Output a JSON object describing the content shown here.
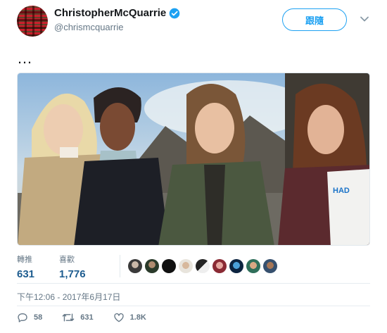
{
  "user": {
    "display_name": "ChristopherMcQuarrie",
    "handle": "@chrismcquarrie",
    "verified": true
  },
  "follow_button": {
    "label": "跟隨"
  },
  "tweet": {
    "text": "…"
  },
  "stats": {
    "retweets_label": "轉推",
    "retweets_value": "631",
    "likes_label": "喜歡",
    "likes_value": "1,776",
    "likers_count_shown": 10
  },
  "timestamp": "下午12:06 - 2017年6月17日",
  "actions": {
    "reply_count": "58",
    "retweet_count": "631",
    "like_count": "1.8K"
  },
  "colors": {
    "brand": "#1da1f2",
    "stat_value": "#1d5c8f",
    "muted": "#657786"
  },
  "icons": [
    "verified-badge-icon",
    "chevron-down-icon",
    "reply-icon",
    "retweet-icon",
    "like-icon"
  ]
}
